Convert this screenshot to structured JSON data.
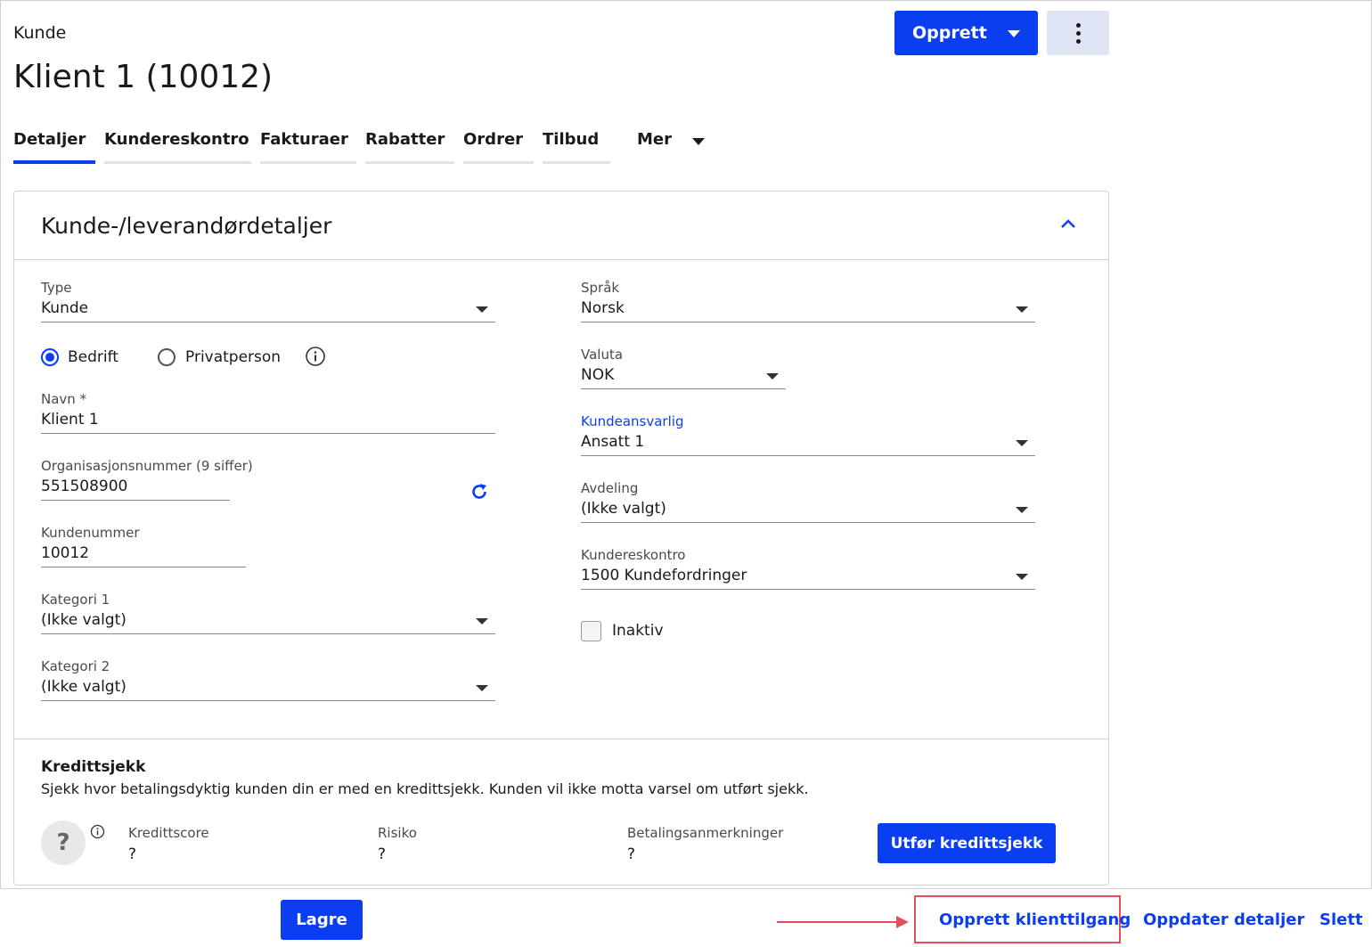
{
  "header": {
    "breadcrumb": "Kunde",
    "title": "Klient 1 (10012)",
    "create_label": "Opprett",
    "more_icon": "vertical-dots-icon"
  },
  "tabs": [
    {
      "label": "Detaljer",
      "active": true
    },
    {
      "label": "Kundereskontro"
    },
    {
      "label": "Fakturaer"
    },
    {
      "label": "Rabatter"
    },
    {
      "label": "Ordrer"
    },
    {
      "label": "Tilbud"
    },
    {
      "label": "Mer"
    }
  ],
  "card": {
    "title": "Kunde-/leverandørdetaljer",
    "left": {
      "type": {
        "label": "Type",
        "value": "Kunde"
      },
      "radio_company": "Bedrift",
      "radio_private": "Privatperson",
      "selected_radio": "Bedrift",
      "name": {
        "label": "Navn *",
        "value": "Klient 1"
      },
      "orgnr": {
        "label": "Organisasjonsnummer (9 siffer)",
        "value": "551508900"
      },
      "customer_number": {
        "label": "Kundenummer",
        "value": "10012"
      },
      "category1": {
        "label": "Kategori 1",
        "value": "(Ikke valgt)"
      },
      "category2": {
        "label": "Kategori 2",
        "value": "(Ikke valgt)"
      }
    },
    "right": {
      "language": {
        "label": "Språk",
        "value": "Norsk"
      },
      "currency": {
        "label": "Valuta",
        "value": "NOK"
      },
      "responsible": {
        "label": "Kundeansvarlig",
        "value": "Ansatt 1"
      },
      "department": {
        "label": "Avdeling",
        "value": "(Ikke valgt)"
      },
      "ledger": {
        "label": "Kundereskontro",
        "value": "1500 Kundefordringer"
      },
      "inactive_label": "Inaktiv",
      "inactive_checked": false
    },
    "credit": {
      "title": "Kredittsjekk",
      "description": "Sjekk hvor betalingsdyktig kunden din er med en kredittsjekk. Kunden vil ikke motta varsel om utført sjekk.",
      "score_symbol": "?",
      "score_label": "Kredittscore",
      "score_value": "?",
      "risk_label": "Risiko",
      "risk_value": "?",
      "remarks_label": "Betalingsanmerkninger",
      "remarks_value": "?",
      "button_label": "Utfør kredittsjekk"
    }
  },
  "footer": {
    "save_label": "Lagre",
    "client_access_label": "Opprett klienttilgang",
    "update_label": "Oppdater detaljer",
    "delete_label": "Slett"
  },
  "colors": {
    "accent": "#0b3ef0",
    "annotation": "#e0505a"
  }
}
